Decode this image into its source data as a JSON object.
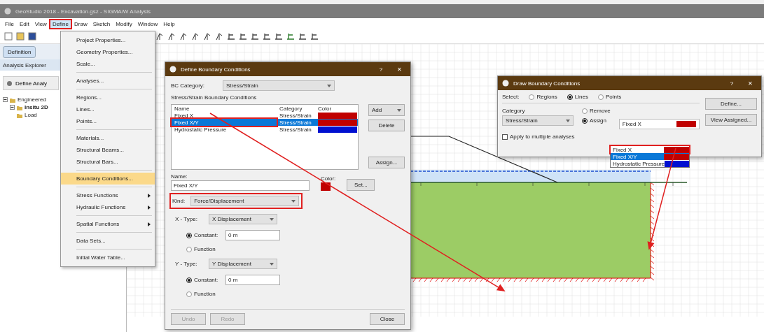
{
  "window": {
    "title": "GeoStudio 2018 - Excavation.gsz - SIGMA/W Analysis"
  },
  "menu_bar": [
    {
      "label": "File",
      "selected": false
    },
    {
      "label": "Edit",
      "selected": false
    },
    {
      "label": "View",
      "selected": false
    },
    {
      "label": "Define",
      "selected": true
    },
    {
      "label": "Draw",
      "selected": false
    },
    {
      "label": "Sketch",
      "selected": false
    },
    {
      "label": "Modify",
      "selected": false
    },
    {
      "label": "Window",
      "selected": false
    },
    {
      "label": "Help",
      "selected": false
    }
  ],
  "view_tabs": [
    {
      "label": "Definition",
      "selected": true
    }
  ],
  "explorer": {
    "title": "Analysis Explorer",
    "define_button": "Define Analy",
    "tree": [
      {
        "label": "Engineered",
        "expanded": true,
        "children": [
          {
            "label": "Insitu 2D",
            "expanded": true,
            "children": [
              {
                "label": "Load"
              }
            ]
          }
        ]
      }
    ]
  },
  "define_menu": [
    [
      {
        "label": "Project Properties...",
        "highlighted": false,
        "submenu": false
      },
      {
        "label": "Geometry Properties...",
        "highlighted": false,
        "submenu": false
      },
      {
        "label": "Scale...",
        "highlighted": false,
        "submenu": false
      }
    ],
    [
      {
        "label": "Analyses...",
        "highlighted": false,
        "submenu": false
      }
    ],
    [
      {
        "label": "Regions...",
        "highlighted": false,
        "submenu": false
      },
      {
        "label": "Lines...",
        "highlighted": false,
        "submenu": false
      },
      {
        "label": "Points...",
        "highlighted": false,
        "submenu": false
      }
    ],
    [
      {
        "label": "Materials...",
        "highlighted": false,
        "submenu": false
      },
      {
        "label": "Structural Beams...",
        "highlighted": false,
        "submenu": false
      },
      {
        "label": "Structural Bars...",
        "highlighted": false,
        "submenu": false
      }
    ],
    [
      {
        "label": "Boundary Conditions...",
        "highlighted": true,
        "submenu": false
      }
    ],
    [
      {
        "label": "Stress Functions",
        "highlighted": false,
        "submenu": true
      },
      {
        "label": "Hydraulic Functions",
        "highlighted": false,
        "submenu": true
      }
    ],
    [
      {
        "label": "Spatial Functions",
        "highlighted": false,
        "submenu": true
      }
    ],
    [
      {
        "label": "Data Sets...",
        "highlighted": false,
        "submenu": false
      }
    ],
    [
      {
        "label": "Initial Water Table...",
        "highlighted": false,
        "submenu": false
      }
    ]
  ],
  "define_dialog": {
    "title": "Define Boundary Conditions",
    "help": "?",
    "close": "✕",
    "bc_category": {
      "label": "BC Category:",
      "value": "Stress/Strain"
    },
    "list_title": "Stress/Strain Boundary Conditions",
    "columns": [
      "Name",
      "Category",
      "Color"
    ],
    "rows": [
      {
        "name": "Fixed X",
        "category": "Stress/Strain",
        "color": "#c00000",
        "selected": false,
        "highlighted": false
      },
      {
        "name": "Fixed X/Y",
        "category": "Stress/Strain",
        "color": "#c00000",
        "selected": true,
        "highlighted": true
      },
      {
        "name": "Hydrostatic Pressure",
        "category": "Stress/Strain",
        "color": "#0010d0",
        "selected": false,
        "highlighted": false
      }
    ],
    "add_button": "Add",
    "delete_button": "Delete",
    "assign_button": "Assign...",
    "name": {
      "label": "Name:",
      "value": "Fixed X/Y"
    },
    "color": {
      "label": "Color:",
      "color": "#c00000",
      "button": "Set..."
    },
    "kind": {
      "label": "Kind:",
      "value": "Force/Displacement",
      "highlighted": true
    },
    "axes": [
      {
        "label": "X - Type:",
        "value": "X Displacement",
        "options": [
          {
            "label": "Constant:",
            "selected": true,
            "value": "0 m"
          },
          {
            "label": "Function",
            "selected": false
          }
        ]
      },
      {
        "label": "Y - Type:",
        "value": "Y Displacement",
        "options": [
          {
            "label": "Constant:",
            "selected": true,
            "value": "0 m"
          },
          {
            "label": "Function",
            "selected": false
          }
        ]
      }
    ],
    "undo_button": "Undo",
    "redo_button": "Redo",
    "close_button": "Close"
  },
  "draw_dialog": {
    "title": "Draw Boundary Conditions",
    "help": "?",
    "close": "✕",
    "select": {
      "label": "Select:",
      "options": [
        {
          "label": "Regions",
          "selected": false
        },
        {
          "label": "Lines",
          "selected": true
        },
        {
          "label": "Points",
          "selected": false
        }
      ]
    },
    "category": {
      "label": "Category",
      "value": "Stress/Strain"
    },
    "modes": [
      {
        "label": "Remove",
        "selected": false
      },
      {
        "label": "Assign",
        "selected": true
      }
    ],
    "assign_value": {
      "name": "Fixed X",
      "color": "#c00000"
    },
    "dropdown_items": [
      {
        "name": "Fixed X",
        "color": "#c00000",
        "selected": false,
        "highlighted": true
      },
      {
        "name": "Fixed X/Y",
        "color": "#c00000",
        "selected": true,
        "highlighted": false
      },
      {
        "name": "Hydrostatic Pressure",
        "color": "#0010d0",
        "selected": false,
        "highlighted": false
      }
    ],
    "apply": {
      "label": "Apply to multiple analyses",
      "checked": false
    },
    "define_button": "Define...",
    "view_button": "View Assigned..."
  }
}
